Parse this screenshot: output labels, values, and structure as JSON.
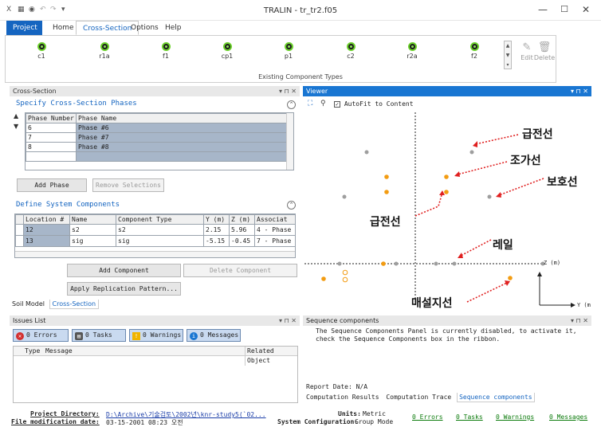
{
  "window": {
    "title": "TRALIN - tr_tr2.f05",
    "quick_access": [
      "X",
      "▦",
      "◉",
      "↶",
      "↷",
      "▾"
    ],
    "controls": [
      "—",
      "☐",
      "✕"
    ]
  },
  "ribbon": {
    "tabs": [
      {
        "label": "Project"
      },
      {
        "label": "Home"
      },
      {
        "label": "Cross-Section"
      },
      {
        "label": "Options"
      },
      {
        "label": "Help"
      }
    ],
    "components": [
      "c1",
      "r1a",
      "f1",
      "cp1",
      "p1",
      "c2",
      "r2a",
      "f2"
    ],
    "group_label": "Existing Component Types",
    "edit_label": "Edit",
    "delete_label": "Delete"
  },
  "cross_section_panel": {
    "header": "Cross-Section",
    "header_controls": "▾ ⊓ ✕",
    "phases_title": "Specify Cross-Section Phases",
    "phase_columns": [
      "Phase Number",
      "Phase Name"
    ],
    "phases": [
      {
        "number": "6",
        "name": "Phase #6"
      },
      {
        "number": "7",
        "name": "Phase #7"
      },
      {
        "number": "8",
        "name": "Phase #8"
      }
    ],
    "add_phase": "Add Phase",
    "remove_selections": "Remove Selections",
    "components_title": "Define System Components",
    "component_columns": [
      "Location #",
      "Name",
      "Component Type",
      "Y (m)",
      "Z (m)",
      "Associat"
    ],
    "components": [
      {
        "location": "12",
        "name": "s2",
        "type": "s2",
        "y": "2.15",
        "z": "5.96",
        "assoc": "4 - Phase"
      },
      {
        "location": "13",
        "name": "sig",
        "type": "sig",
        "y": "-5.15",
        "z": "-0.45",
        "assoc": "7 - Phase"
      }
    ],
    "add_component": "Add Component",
    "delete_component": "Delete Component",
    "apply_replication": "Apply Replication Pattern...",
    "bottom_tabs": [
      "Soil Model",
      "Cross-Section"
    ]
  },
  "viewer": {
    "header": "Viewer",
    "header_controls": "▾ ⊓ ✕",
    "autofit_label": "AutoFit to Content",
    "z_axis_label": "Z (m)",
    "y_axis_label": "Y (m",
    "annotations": [
      "급전선",
      "조가선",
      "보호선",
      "급전선",
      "레일",
      "매설지선"
    ],
    "colors": {
      "orange": "#f39c12",
      "gray": "#9e9e9e",
      "red": "#e02020"
    }
  },
  "issues": {
    "header": "Issues List",
    "header_controls": "▾ ⊓ ✕",
    "errors": "0 Errors",
    "tasks": "0 Tasks",
    "warnings": "0 Warnings",
    "messages": "0 Messages",
    "columns": [
      "Type",
      "Message",
      "Related Object"
    ]
  },
  "sequence": {
    "header": "Sequence components",
    "header_controls": "▾ ⊓ ✕",
    "message": "The Sequence Components Panel is currently disabled, to activate it, check the Sequence Components box in the ribbon.",
    "report_date": "Report Date: N/A",
    "tabs": [
      "Computation Results",
      "Computation Trace",
      "Sequence components"
    ]
  },
  "status": {
    "project_dir_label": "Project Directory:",
    "project_dir_value": "D:\\Archive\\기술검토\\2002년\\knr-study5(`02...",
    "file_mod_label": "File modification date:",
    "file_mod_value": "03-15-2001 08:23 오전",
    "units_label": "Units:",
    "units_value": "Metric",
    "sys_config_label": "System Configuration:",
    "sys_config_value": "Group Mode",
    "errors": "0 Errors",
    "tasks": "0 Tasks",
    "warnings": "0 Warnings",
    "messages": "0 Messages"
  }
}
